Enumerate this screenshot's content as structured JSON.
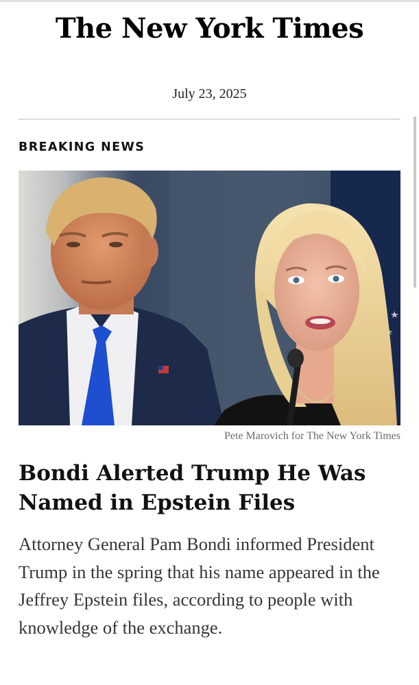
{
  "masthead": {
    "title": "The New York Times"
  },
  "date": "July 23, 2025",
  "section_kicker": "BREAKING NEWS",
  "photo": {
    "alt": "Pam Bondi speaking at a microphone with Donald Trump in the background",
    "credit": "Pete Marovich for The New York Times"
  },
  "article": {
    "headline": "Bondi Alerted Trump He Was Named in Epstein Files",
    "summary": "Attorney General Pam Bondi informed President Trump in the spring that his name appeared in the Jeffrey Epstein files, according to people with knowledge of the exchange."
  },
  "colors": {
    "text": "#121212",
    "summary_text": "#363636",
    "credit_text": "#6a6a6a",
    "divider": "#dcdcdc"
  }
}
